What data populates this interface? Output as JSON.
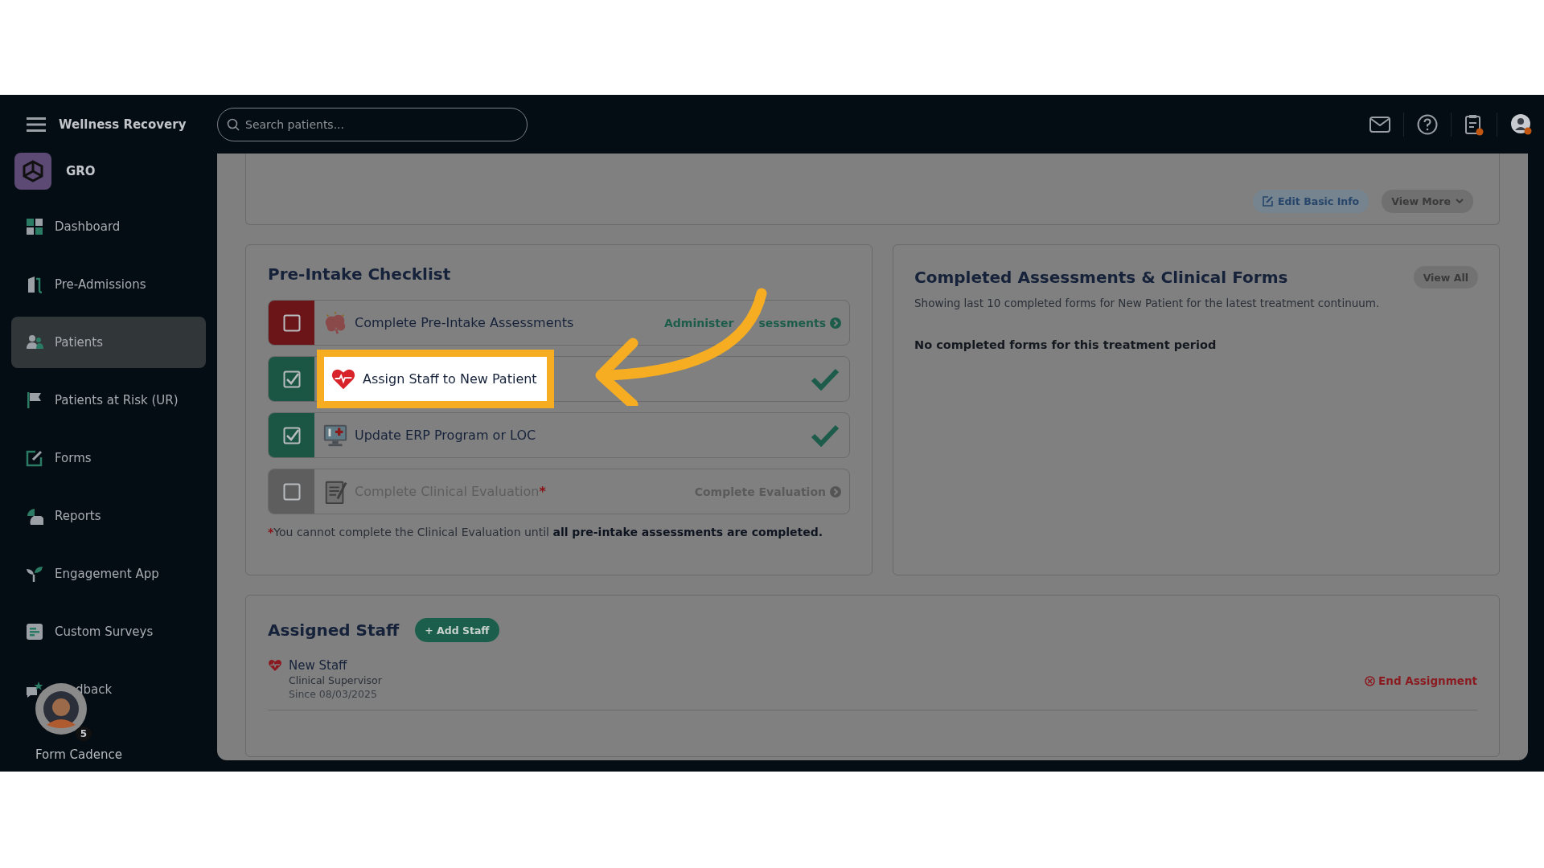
{
  "app": {
    "title": "Wellness Recovery",
    "organization": "GRO"
  },
  "search": {
    "placeholder": "Search patients..."
  },
  "nav": [
    {
      "label": "Dashboard",
      "kind": "dashboard",
      "selected": false
    },
    {
      "label": "Pre-Admissions",
      "kind": "door",
      "selected": false
    },
    {
      "label": "Patients",
      "kind": "people",
      "selected": true
    },
    {
      "label": "Patients at Risk (UR)",
      "kind": "flag",
      "selected": false
    },
    {
      "label": "Forms",
      "kind": "edit",
      "selected": false
    },
    {
      "label": "Reports",
      "kind": "pie",
      "selected": false
    },
    {
      "label": "Engagement App",
      "kind": "sprout",
      "selected": false
    },
    {
      "label": "Custom Surveys",
      "kind": "survey",
      "selected": false
    },
    {
      "label": "dback",
      "kind": "chat",
      "selected": false
    }
  ],
  "widget": {
    "badge": "5",
    "label": "Form Cadence"
  },
  "patient_card": {
    "buttons": [
      {
        "label": "Edit Basic Info",
        "kind": "edit"
      },
      {
        "label": "View More",
        "kind": "more"
      }
    ]
  },
  "checklist": {
    "title": "Pre-Intake Checklist",
    "items": [
      {
        "label": "Complete Pre-Intake Assessments",
        "kind": "brain",
        "checked": false,
        "disabled": false,
        "highlighted": false,
        "action_parts": [
          "Administer",
          "sessments"
        ]
      },
      {
        "label": "Assign Staff to New Patient",
        "kind": "heart",
        "checked": true,
        "disabled": false,
        "highlighted": true
      },
      {
        "label": "Update ERP Program or LOC",
        "kind": "monitor",
        "checked": true,
        "disabled": false,
        "highlighted": false
      },
      {
        "label": "Complete Clinical Evaluation",
        "kind": "clipboard",
        "checked": false,
        "disabled": true,
        "highlighted": false,
        "mark": "*",
        "action_parts": [
          "Complete Evaluation"
        ]
      }
    ],
    "note_mark": "*",
    "note": "You cannot complete the Clinical Evaluation until **all pre-intake assessments are completed.**"
  },
  "completed_forms": {
    "title": "Completed Assessments & Clinical Forms",
    "subtitle": "Showing last 10 completed forms for New Patient for the latest treatment continuum.",
    "button": "View All",
    "empty": "No completed forms for this treatment period"
  },
  "assigned_staff": {
    "title": "Assigned Staff",
    "add_button": "+ Add Staff",
    "staff": [
      {
        "name": "New Staff",
        "role": "Clinical Supervisor",
        "since": "Since 08/03/2025",
        "action": "End Assignment"
      }
    ]
  }
}
